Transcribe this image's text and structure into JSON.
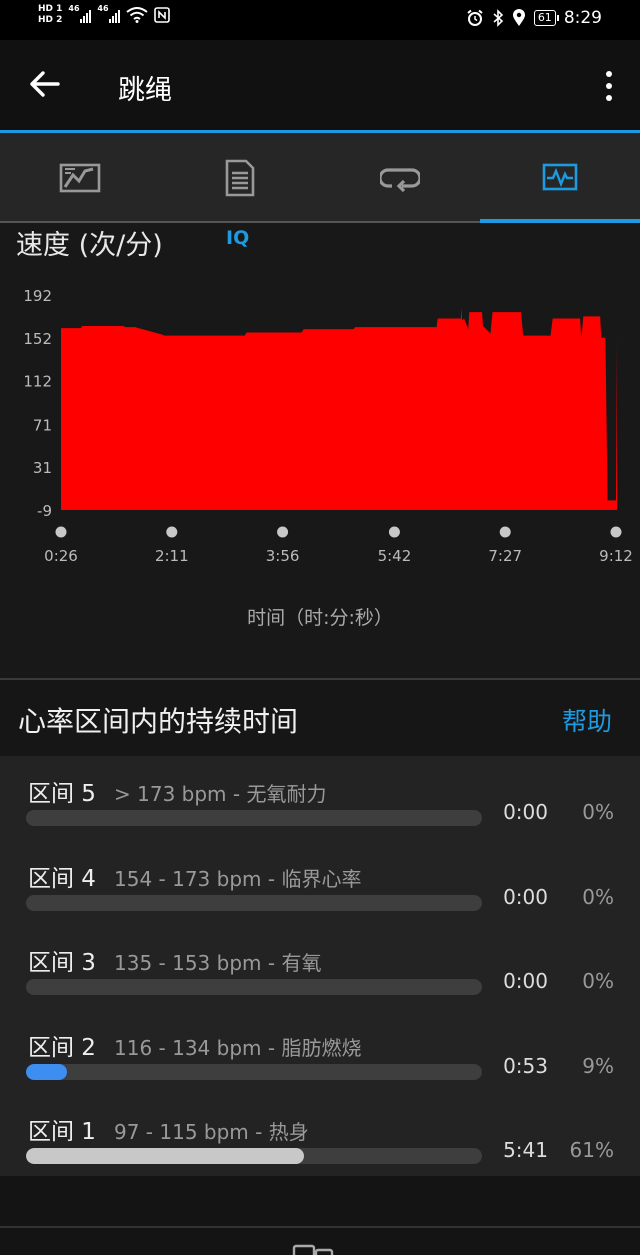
{
  "status_bar": {
    "hd1": "HD 1",
    "hd2": "HD 2",
    "net1": "46",
    "net2": "46",
    "battery": "61",
    "time": "8:29"
  },
  "app": {
    "title": "跳绳",
    "accent_color": "#1e9be0"
  },
  "tabs": [
    {
      "icon": "map-icon"
    },
    {
      "icon": "document-icon"
    },
    {
      "icon": "laps-icon"
    },
    {
      "icon": "chart-icon",
      "active": true
    }
  ],
  "chart": {
    "title": "速度 (次/分)",
    "badge": "IQ",
    "xlabel": "时间（时:分:秒）"
  },
  "chart_data": {
    "type": "area",
    "title": "速度 (次/分)",
    "xlabel": "时间（时:分:秒）",
    "ylabel": "",
    "color": "#ff0000",
    "y_ticks": [
      "192",
      "152",
      "112",
      "71",
      "31",
      "-9"
    ],
    "y_tick_values": [
      192,
      152,
      112,
      71,
      31,
      -9
    ],
    "x_ticks": [
      "0:26",
      "2:11",
      "3:56",
      "5:42",
      "7:27",
      "9:12"
    ],
    "x_tick_seconds": [
      26,
      131,
      236,
      342,
      447,
      552
    ],
    "ylim": [
      -9,
      192
    ],
    "series": [
      {
        "x": [
          26,
          45,
          46,
          85,
          87,
          95,
          96,
          122,
          124,
          200,
          202,
          254,
          256,
          303,
          305,
          382,
          383,
          405,
          406,
          406,
          408,
          412,
          413,
          425,
          426,
          433,
          435,
          462,
          464,
          490,
          492,
          518,
          519,
          520,
          521,
          537,
          538,
          542,
          544,
          552,
          553
        ],
        "y": [
          161,
          161,
          163,
          163,
          162,
          162,
          162,
          155,
          154,
          154,
          157,
          157,
          160,
          160,
          162,
          162,
          170,
          170,
          180,
          168,
          170,
          160,
          176,
          176,
          163,
          156,
          176,
          176,
          154,
          154,
          170,
          170,
          152,
          160,
          172,
          172,
          152,
          152,
          0,
          0,
          155
        ]
      }
    ],
    "grid": false,
    "legend": "none"
  },
  "zones_section": {
    "title": "心率区间内的持续时间",
    "help": "帮助",
    "zones": [
      {
        "name": "区间 5",
        "range": "> 173 bpm - 无氧耐力",
        "time": "0:00",
        "pct": "0%",
        "fraction": 0,
        "color": "#3e3e3e"
      },
      {
        "name": "区间 4",
        "range": "154 - 173 bpm - 临界心率",
        "time": "0:00",
        "pct": "0%",
        "fraction": 0,
        "color": "#3e3e3e"
      },
      {
        "name": "区间 3",
        "range": "135 - 153 bpm - 有氧",
        "time": "0:00",
        "pct": "0%",
        "fraction": 0,
        "color": "#3e3e3e"
      },
      {
        "name": "区间 2",
        "range": "116 - 134 bpm - 脂肪燃烧",
        "time": "0:53",
        "pct": "9%",
        "fraction": 0.09,
        "color": "#3d8ef0"
      },
      {
        "name": "区间 1",
        "range": "97 - 115 bpm - 热身",
        "time": "5:41",
        "pct": "61%",
        "fraction": 0.61,
        "color": "#c8c8c8"
      }
    ]
  }
}
